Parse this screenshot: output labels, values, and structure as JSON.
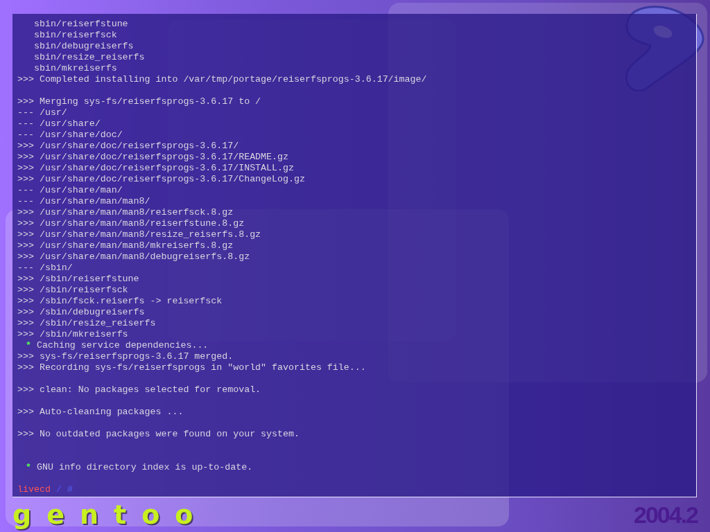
{
  "terminal": {
    "lines": [
      {
        "kind": "text",
        "text": "   sbin/reiserfstune"
      },
      {
        "kind": "text",
        "text": "   sbin/reiserfsck"
      },
      {
        "kind": "text",
        "text": "   sbin/debugreiserfs"
      },
      {
        "kind": "text",
        "text": "   sbin/resize_reiserfs"
      },
      {
        "kind": "text",
        "text": "   sbin/mkreiserfs"
      },
      {
        "kind": "text",
        "text": ">>> Completed installing into /var/tmp/portage/reiserfsprogs-3.6.17/image/"
      },
      {
        "kind": "blank"
      },
      {
        "kind": "text",
        "text": ">>> Merging sys-fs/reiserfsprogs-3.6.17 to /"
      },
      {
        "kind": "text",
        "text": "--- /usr/"
      },
      {
        "kind": "text",
        "text": "--- /usr/share/"
      },
      {
        "kind": "text",
        "text": "--- /usr/share/doc/"
      },
      {
        "kind": "text",
        "text": ">>> /usr/share/doc/reiserfsprogs-3.6.17/"
      },
      {
        "kind": "text",
        "text": ">>> /usr/share/doc/reiserfsprogs-3.6.17/README.gz"
      },
      {
        "kind": "text",
        "text": ">>> /usr/share/doc/reiserfsprogs-3.6.17/INSTALL.gz"
      },
      {
        "kind": "text",
        "text": ">>> /usr/share/doc/reiserfsprogs-3.6.17/ChangeLog.gz"
      },
      {
        "kind": "text",
        "text": "--- /usr/share/man/"
      },
      {
        "kind": "text",
        "text": "--- /usr/share/man/man8/"
      },
      {
        "kind": "text",
        "text": ">>> /usr/share/man/man8/reiserfsck.8.gz"
      },
      {
        "kind": "text",
        "text": ">>> /usr/share/man/man8/reiserfstune.8.gz"
      },
      {
        "kind": "text",
        "text": ">>> /usr/share/man/man8/resize_reiserfs.8.gz"
      },
      {
        "kind": "text",
        "text": ">>> /usr/share/man/man8/mkreiserfs.8.gz"
      },
      {
        "kind": "text",
        "text": ">>> /usr/share/man/man8/debugreiserfs.8.gz"
      },
      {
        "kind": "text",
        "text": "--- /sbin/"
      },
      {
        "kind": "text",
        "text": ">>> /sbin/reiserfstune"
      },
      {
        "kind": "text",
        "text": ">>> /sbin/reiserfsck"
      },
      {
        "kind": "text",
        "text": ">>> /sbin/fsck.reiserfs -> reiserfsck"
      },
      {
        "kind": "text",
        "text": ">>> /sbin/debugreiserfs"
      },
      {
        "kind": "text",
        "text": ">>> /sbin/resize_reiserfs"
      },
      {
        "kind": "text",
        "text": ">>> /sbin/mkreiserfs"
      },
      {
        "kind": "star",
        "mark": "*",
        "text": "Caching service dependencies..."
      },
      {
        "kind": "text",
        "text": ">>> sys-fs/reiserfsprogs-3.6.17 merged."
      },
      {
        "kind": "text",
        "text": ">>> Recording sys-fs/reiserfsprogs in \"world\" favorites file..."
      },
      {
        "kind": "blank"
      },
      {
        "kind": "text",
        "text": ">>> clean: No packages selected for removal."
      },
      {
        "kind": "blank"
      },
      {
        "kind": "text",
        "text": ">>> Auto-cleaning packages ..."
      },
      {
        "kind": "blank"
      },
      {
        "kind": "text",
        "text": ">>> No outdated packages were found on your system."
      },
      {
        "kind": "blank"
      },
      {
        "kind": "blank"
      },
      {
        "kind": "star",
        "mark": "*",
        "text": "GNU info directory index is up-to-date."
      },
      {
        "kind": "blank"
      },
      {
        "kind": "prompt",
        "host": "livecd",
        "path": "/",
        "symbol": "#"
      }
    ]
  },
  "footer": {
    "wordmark": "gentoo",
    "version": "2004.2"
  }
}
